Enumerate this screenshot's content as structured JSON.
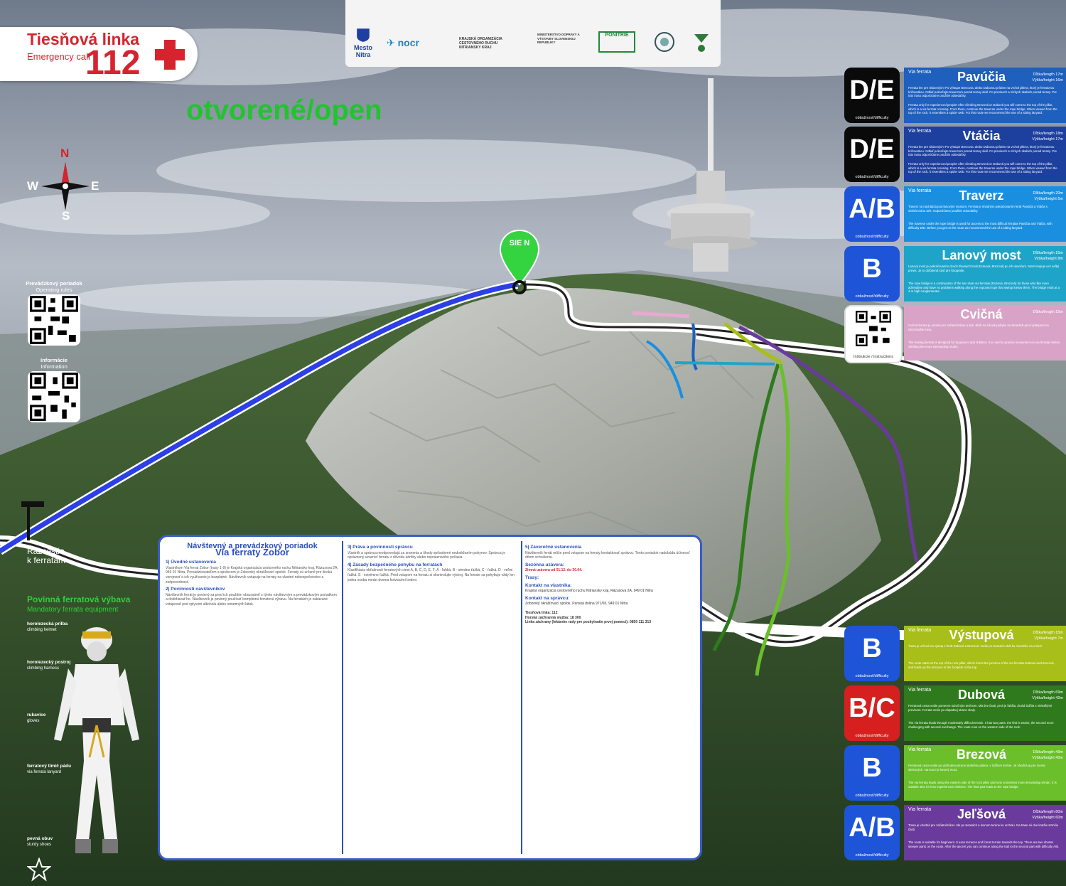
{
  "emergency": {
    "title": "Tiesňová linka",
    "subtitle": "Emergency call",
    "number": "112"
  },
  "sponsors": [
    {
      "name": "Mesto Nitra",
      "icon": "city-crest-icon"
    },
    {
      "name": "nocr",
      "icon": "nocr-logo-icon"
    },
    {
      "name": "KRAJSKÁ ORGANIZÁCIA CESTOVNÉHO RUCHU NITRIANSKY KRAJ",
      "icon": "kocr-logo-icon"
    },
    {
      "name": "MINISTERSTVO DOPRAVY A VÝSTAVBY SLOVENSKEJ REPUBLIKY",
      "icon": "ministry-logo-icon"
    },
    {
      "name": "PONITRIE",
      "icon": "ponitrie-logo-icon"
    },
    {
      "name": "",
      "icon": "round-badge-icon"
    },
    {
      "name": "",
      "icon": "wine-route-logo-icon"
    }
  ],
  "status": {
    "label": "otvorené/open",
    "color": "#22c32f"
  },
  "compass": {
    "n": "N",
    "s": "S",
    "e": "E",
    "w": "W"
  },
  "qr": [
    {
      "title": "Prevádzkový poriadok",
      "sub": "Operating rules"
    },
    {
      "title": "Informácie",
      "sub": "Information"
    }
  ],
  "junction": {
    "line1": "Rázcestie",
    "line2": "k ferratám"
  },
  "peak_marker": {
    "label": "SIE N"
  },
  "routes": [
    {
      "grade": "D/E",
      "badge_color": "#0a0a0a",
      "panel_color": "#1f5fbd",
      "label": "Via ferrata",
      "name": "Pavúčia",
      "stats": "Dĺžka/length 17m Výška/height 16m",
      "d1": "Ferrata len pre skúsených! Po výstupe Brezovou alebo Dubovou prídete na vrchol piliera, ktorý je ferratovou križovatkou. Odtiaľ pokračujte traverzom ponad terasy skál. Po previsoch a nízkych skalách ponad terasy. Pre túto trasu odporúčame použitie odsedačky.",
      "d2": "Ferrata only for experienced people! After climbing Brezová or Dubová you will come to the top of the pillar, which is a via ferrata crossing. From there, continue the traverse under the rope bridge. When viewed from the top of the rock, it resembles a spider web. For this route we recommend the use of a sitting lanyard."
    },
    {
      "grade": "D/E",
      "badge_color": "#0a0a0a",
      "panel_color": "#1d3f9e",
      "label": "Via ferrata",
      "name": "Vtáčia",
      "stats": "Dĺžka/length 18m Výška/height 17m",
      "d1": "Ferrata len pre skúsených! Po výstupe Brezovou alebo Dubovou prídete na vrchol piliera, ktorý je ferratovou križovatkou. Odtiaľ pokračujte traverzom ponad terasy skál. Po previsoch a nízkych skalách ponad terasy. Pre túto trasu odporúčame použitie odsedačky.",
      "d2": "Ferrata only for experienced people! After climbing Brezová or Dubová you will come to the top of the pillar, which is a via ferrata crossing. From there, continue the traverse under the rope bridge. When viewed from the top of the rock, it resembles a spider web. For this route we recommend the use of a sitting lanyard."
    },
    {
      "grade": "A/B",
      "badge_color": "#1e54d8",
      "panel_color": "#1a8fe0",
      "label": "Via ferrata",
      "name": "Traverz",
      "stats": "Dĺžka/length 20m Výška/height 5m",
      "d1": "Traverz sa nachádza pod lanovým mostom. Ferrata je vhodným pokračovaním ferát Pavúčia a Vtáčia s obťažnosťou D/E. Odporúčame použitie odsedačky.",
      "d2": "The traverse under the rope bridge is used for access to the most difficult ferratas Pavúčia and Vtáčia, with difficulty D/E. Before you get on the route we recommend the use of a sitting lanyard."
    },
    {
      "grade": "B",
      "badge_color": "#1e54d8",
      "panel_color": "#1fa4c9",
      "label": "",
      "name": "Lanový most",
      "stats": "Dĺžka/length 15m Výška/height 8m",
      "d1": "Lanový most je pokračovaním dvoch hlavných ferát (Dubová, Brezová) po ich ukončení. Most mapuje cez veľký previs. Je to obľúbená časť pre fotografie.",
      "d2": "The rope bridge is a continuation of the two main via ferratas (Dubová, Brezová) for those who like more adrenaline and have no problems walking along the exposed rope that swings below them. The bridge ends at a 4 m high conglomerate.",
      "_": ""
    },
    {
      "grade": "",
      "badge_color": "#ffffff",
      "panel_color": "#d9a3c7",
      "label": "",
      "name": "Cvičná",
      "stats": "Dĺžka/length 15m",
      "qr_caption": "Inštrukcie / instructions",
      "d1": "Cvičná ferrata je určená pre začiatočníkov a deti. Slúži na nácvik pohybu na ferratách pred výstupom na náročnejšie trasy.",
      "d2": "The training ferrata is designed for beginners and children. It is used to practice movement on via ferratas before climbing the more demanding routes."
    },
    {
      "grade": "B",
      "badge_color": "#1e54d8",
      "panel_color": "#a7bf18",
      "label": "Via ferrata",
      "name": "Výstupová",
      "stats": "Dĺžka/length 15m Výška/height 7m",
      "d1": "Trasa je určená na výstup z ferát Dubová a Brezová. Vedie po terasách skál ku chodníku na vrchol.",
      "d2": "The route starts at the top of the rock pillar, which forms the junction of the via ferratas Dubová and Brezová, and leads up the terraces to the footpath at the top."
    },
    {
      "grade": "B/C",
      "badge_color": "#d62020",
      "panel_color": "#2e7a1c",
      "label": "Via ferrata",
      "name": "Dubová",
      "stats": "Dĺžka/length 69m Výška/height 42m",
      "d1": "Ferratová cesta vedie pomerne náročným terénom. Má dve časti, prvá je ľahšia, druhá ťažšia s niekoľkými previsom. Ferrata vedie po západnej strane skaly.",
      "d2": "The via ferrata leads through moderately difficult terrain. It has two parts, the first is easier, the second more challenging with several overhangs. The route runs on the western side of the rock."
    },
    {
      "grade": "B",
      "badge_color": "#1e54d8",
      "panel_color": "#6abf2a",
      "label": "Via ferrata",
      "name": "Brezová",
      "stats": "Dĺžka/length 49m Výška/height 40m",
      "d1": "Ferratová cesta vedie po východnej strane skalného piliera, v ťažšom teréne. Je vhodná aj pre menej skúsených. Na konci je lanový most.",
      "d2": "The via ferrata leads along the eastern side of the rock pillar and runs somewhat more demanding terrain. It is suitable also for less experienced climbers. The final part leads to the rope bridge."
    },
    {
      "grade": "A/B",
      "badge_color": "#1e54d8",
      "panel_color": "#6a3a9c",
      "label": "Via ferrata",
      "name": "Jeľšová",
      "stats": "Dĺžka/length 80m Výška/height 60m",
      "d1": "Trasa je vhodná pre začiatočníkov. Ide po terasách a lesnom teréne ku vrcholu. Na trase sú dve kratšie strmšie časti.",
      "d2": "The route is suitable for beginners. It uses terraces and forest terrain towards the top. There are two shorter steeper parts on the route. After the ascent you can continue along the trail to the second part with difficulty A/B."
    }
  ],
  "board": {
    "title": "Návštevný a prevádzkový poriadok",
    "subtitle": "Via ferraty Zobor",
    "sec1": "1| Úvodné ustanovenia",
    "sec1_text": "Vlastníkom Via ferrat Zobor (trasy 1-9) je Krajská organizácia cestovného ruchu Nitriansky kraj, Rázusova 2A, 949 01 Nitra. Prevádzkovateľom a správcom je Zoborský okrášľovací spolok. Ferraty sú určené pre širokú verejnosť a ich využívanie je bezplatné. Návštevník vstupuje na ferraty na vlastné nebezpečenstvo a zodpovednosť.",
    "sec2": "2| Povinnosti návštevníkov",
    "sec2_text": "Návštevník ferrát je povinný sa pred ich použitím oboznámiť s týmto návštevným a prevádzkovým poriadkom a dodržiavať ho. Návštevník je povinný používať kompletnú ferratovú výbavu. Na ferratách je zakázané vstupovať pod vplyvom alkoholu alebo omamných látok.",
    "sec3": "3| Práva a povinnosti správcu",
    "sec3_text": "Vlastník a správca neodpovedajú za zranenia a škody spôsobené nedodržaním pokynov. Správca je oprávnený uzavrieť ferratu z dôvodu údržby alebo nepriaznivého počasia.",
    "sec4": "4| Zásady bezpečného pohybu na ferratách",
    "sec4_text": "Klasifikácia obťažnosti ferratových ciest A, B, C, D, E, F: A - ľahká, B - stredne ťažká, C - ťažká, D - veľmi ťažká, E - extrémne ťažká. Pred vstupom na ferratu si skontrolujte výstroj. Na ferrate sa pohybuje vždy len jedna osoba medzi dvoma kotviacimi bodmi.",
    "sec5": "5| Záverečné ustanovenia",
    "sec5_text": "Návštevník ferrát môže pred vstupom na ferraty kontaktovať správcu. Tento poriadok nadobúda účinnosť dňom schválenia.",
    "season_h": "Sezónna uzávera:",
    "season": "Zimná uzávera od 01.12. do 30.04.",
    "routes_h": "Trasy:",
    "contact_h": "Kontakt na vlastníka:",
    "contact": "Krajská organizácia cestovného ruchu Nitriansky kraj, Rázusova 2A, 949 01 Nitra",
    "admin_h": "Kontakt na správcu:",
    "admin": "Zoborský okrášľovací spolok, Panská dolina 971/65, 949 01 Nitra",
    "rescue": "Tiesňová linka: 112",
    "mountain_rescue": "Horská záchranná služba: 18 300",
    "emergency_line": "Linka záchrany (lekárske rady pre poskytnutie prvej pomoci): 0850 111 313"
  },
  "equipment": {
    "title": "Povinná ferratová výbava",
    "subtitle": "Mandatory ferrata equipment",
    "items": [
      {
        "title": "horolezecká prilba",
        "sub": "climbing helmet"
      },
      {
        "title": "horolezecký postroj",
        "sub": "climbing harness"
      },
      {
        "title": "rukavice",
        "sub": "gloves"
      },
      {
        "title": "ferratový tlmič pádu",
        "sub": "via ferrata lanyard"
      },
      {
        "title": "pevná obuv",
        "sub": "sturdy shoes"
      }
    ]
  },
  "colors": {
    "route_blue": "#2d3fe6",
    "path_white": "#ffffff",
    "accent_red": "#d6242e",
    "board_blue": "#2b4fc0"
  }
}
